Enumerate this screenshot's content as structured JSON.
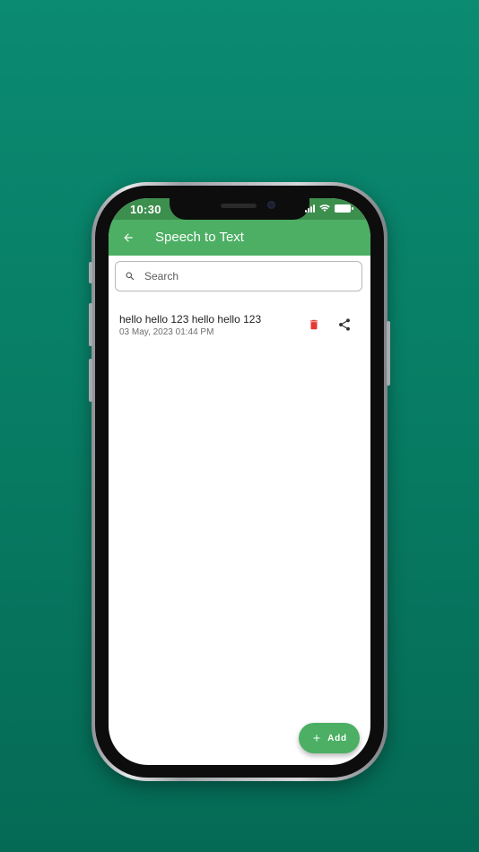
{
  "status_bar": {
    "time": "10:30",
    "icons": [
      "signal-icon",
      "wifi-icon",
      "battery-icon"
    ]
  },
  "app_bar": {
    "title": "Speech to Text",
    "back_icon": "arrow-left-icon"
  },
  "search": {
    "placeholder": "Search",
    "value": "",
    "icon": "search-icon"
  },
  "items": [
    {
      "title": "hello hello 123 hello hello 123",
      "date": "03 May, 2023 01:44 PM",
      "actions": [
        "delete-icon",
        "share-icon"
      ]
    }
  ],
  "fab": {
    "label": "Add",
    "icon": "plus-icon"
  },
  "colors": {
    "background": "#0a8270",
    "primary": "#4caf64",
    "status_bar": "#3d8f4e",
    "delete": "#e53935",
    "share": "#333333",
    "surface": "#ffffff"
  }
}
